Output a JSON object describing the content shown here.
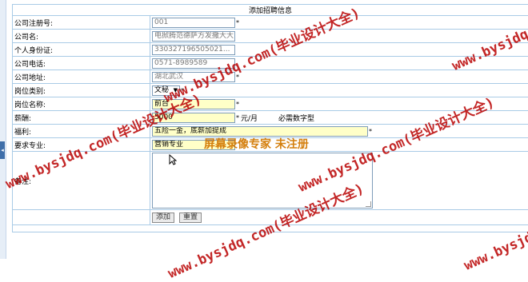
{
  "page_title": "添加招聘信息",
  "fields": {
    "reg_no": {
      "label": "公司注册号:",
      "value": "001",
      "req": "*"
    },
    "name": {
      "label": "公司名:",
      "value": "电掀腾范德萨方发撒大大",
      "req": ""
    },
    "id_card": {
      "label": "个人身份证:",
      "value": "330327196505021...",
      "req": ""
    },
    "phone": {
      "label": "公司电话:",
      "value": "0571-8989589",
      "req": ""
    },
    "address": {
      "label": "公司地址:",
      "value": "湖北武汉",
      "req": "*"
    },
    "category": {
      "label": "岗位类别:",
      "value": "文秘",
      "req": "*"
    },
    "position": {
      "label": "岗位名称:",
      "value": "前台",
      "req": "*"
    },
    "salary": {
      "label": "薪酬:",
      "value": "5000",
      "req": "*",
      "unit": "元/月",
      "hint": "必需数字型"
    },
    "benefits": {
      "label": "福利:",
      "value": "五险一金，底薪加提成",
      "req": "*"
    },
    "major": {
      "label": "要求专业:",
      "value": "营销专业",
      "req": ""
    },
    "notes": {
      "label": "备注:",
      "value": ""
    }
  },
  "buttons": {
    "add": "添加",
    "reset": "重置"
  },
  "watermarks": {
    "site": "www.bysjdq.com(毕业设计大全)",
    "recorder": "屏幕录像专家  未注册"
  },
  "sidebar_tab": "◂"
}
